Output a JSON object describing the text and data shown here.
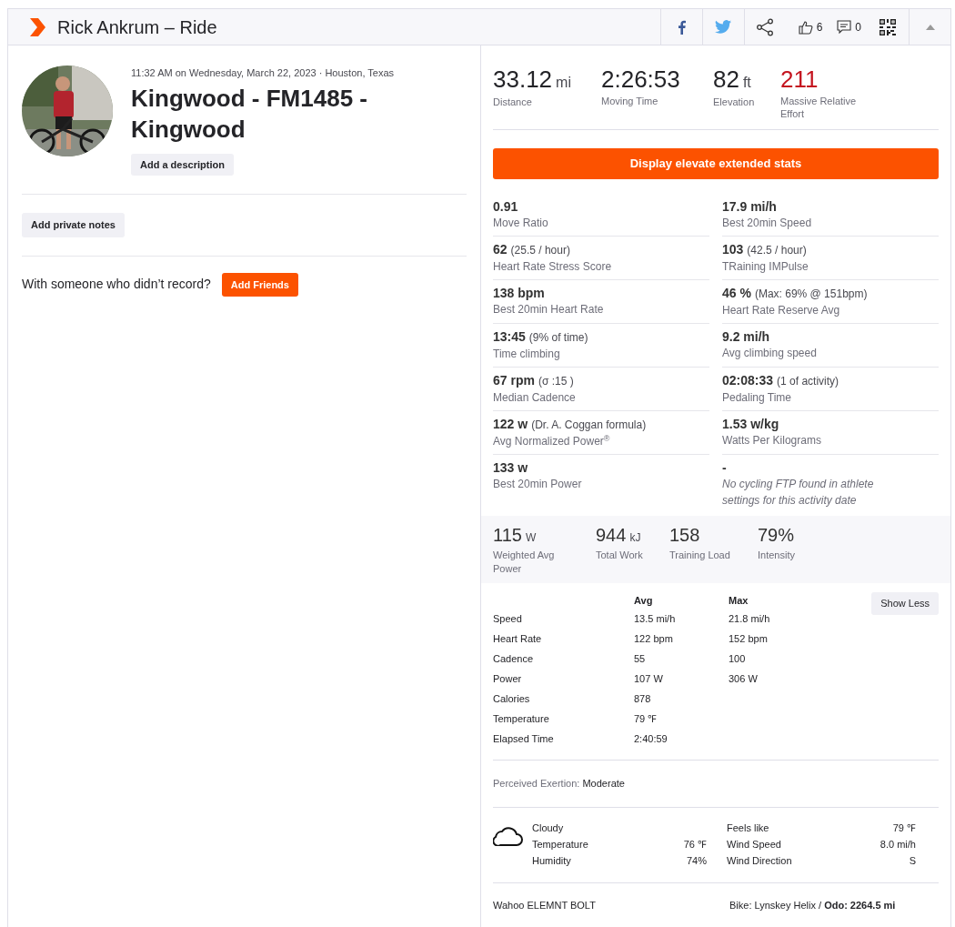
{
  "header": {
    "title": "Rick Ankrum – Ride",
    "likes": "6",
    "comments": "0"
  },
  "activity": {
    "meta": "11:32 AM on Wednesday, March 22, 2023 · Houston, Texas",
    "title": "Kingwood - FM1485 - Kingwood",
    "description_button": "Add a description",
    "notes_button": "Add private notes",
    "friends_prompt": "With someone who didn’t record?",
    "friends_button": "Add Friends"
  },
  "summary": [
    {
      "value": "33.12",
      "unit": "mi",
      "label": "Distance",
      "color": "#242428"
    },
    {
      "value": "2:26:53",
      "label": "Moving Time",
      "color": "#242428"
    },
    {
      "value": "82",
      "unit": "ft",
      "label": "Elevation",
      "color": "#242428"
    },
    {
      "value": "211",
      "label": "Massive Relative Effort",
      "color": "#c4141f"
    }
  ],
  "extended_button": "Display elevate extended stats",
  "extended_stats": [
    {
      "kind": "stat",
      "value": "0.91",
      "label": "Move Ratio"
    },
    {
      "kind": "stat",
      "value": "17.9 mi/h",
      "label": "Best 20min Speed"
    },
    {
      "kind": "stat",
      "value": "62",
      "note": "(25.5 / hour)",
      "label": "Heart Rate Stress Score"
    },
    {
      "kind": "stat",
      "value": "103",
      "note": "(42.5 / hour)",
      "label": "TRaining IMPulse"
    },
    {
      "kind": "stat",
      "value": "138 bpm",
      "label": "Best 20min Heart Rate"
    },
    {
      "kind": "stat",
      "value": "46 %",
      "note": "(Max: 69% @ 151bpm)",
      "label": "Heart Rate Reserve Avg"
    },
    {
      "kind": "stat",
      "value": "13:45",
      "note": "(9% of time)",
      "label": "Time climbing"
    },
    {
      "kind": "stat",
      "value": "9.2 mi/h",
      "label": "Avg climbing speed"
    },
    {
      "kind": "stat",
      "value": "67 rpm",
      "note": "(σ :15 )",
      "label": "Median Cadence"
    },
    {
      "kind": "stat",
      "value": "02:08:33",
      "note": "(1 of activity)",
      "label": "Pedaling Time"
    },
    {
      "kind": "stat",
      "value": "122 w",
      "note": "(Dr. A. Coggan formula)",
      "label": "Avg Normalized Power$^{®}$"
    },
    {
      "kind": "stat",
      "value": "1.53 w/kg",
      "label": "Watts Per Kilograms"
    },
    {
      "kind": "stat",
      "value": "133 w",
      "label": "Best 20min Power"
    },
    {
      "kind": "warning",
      "value": "-",
      "label": "No cycling FTP found in athlete settings for this activity date"
    }
  ],
  "power_stats": [
    {
      "value": "115",
      "unit": "W",
      "label": "Weighted Avg Power"
    },
    {
      "value": "944",
      "unit": "kJ",
      "label": "Total Work"
    },
    {
      "value": "158",
      "label": "Training Load"
    },
    {
      "value": "79%",
      "label": "Intensity"
    }
  ],
  "details": {
    "columns": [
      "Avg",
      "Max"
    ],
    "show_less_button": "Show Less",
    "rows": [
      {
        "label": "Speed",
        "avg": "13.5 mi/h",
        "max": "21.8 mi/h"
      },
      {
        "label": "Heart Rate",
        "avg": "122 bpm",
        "max": "152 bpm"
      },
      {
        "label": "Cadence",
        "avg": "55",
        "max": "100"
      },
      {
        "label": "Power",
        "avg": "107 W",
        "max": "306 W"
      },
      {
        "label": "Calories",
        "avg": "878"
      },
      {
        "label": "Temperature",
        "avg": "79 ℉"
      },
      {
        "label": "Elapsed Time",
        "avg": "2:40:59"
      }
    ]
  },
  "perceived_exertion": {
    "label": "Perceived Exertion:",
    "value": "Moderate"
  },
  "weather": {
    "condition": "Cloudy",
    "left": [
      {
        "label": "Temperature",
        "value": "76 ℉"
      },
      {
        "label": "Humidity",
        "value": "74%"
      }
    ],
    "right": [
      {
        "label": "Feels like",
        "value": "79 ℉"
      },
      {
        "label": "Wind Speed",
        "value": "8.0 mi/h"
      },
      {
        "label": "Wind Direction",
        "value": "S"
      }
    ]
  },
  "device": "Wahoo ELEMNT BOLT",
  "bike": "Bike: Lynskey Helix / **Odo: 2264.5 mi**"
}
